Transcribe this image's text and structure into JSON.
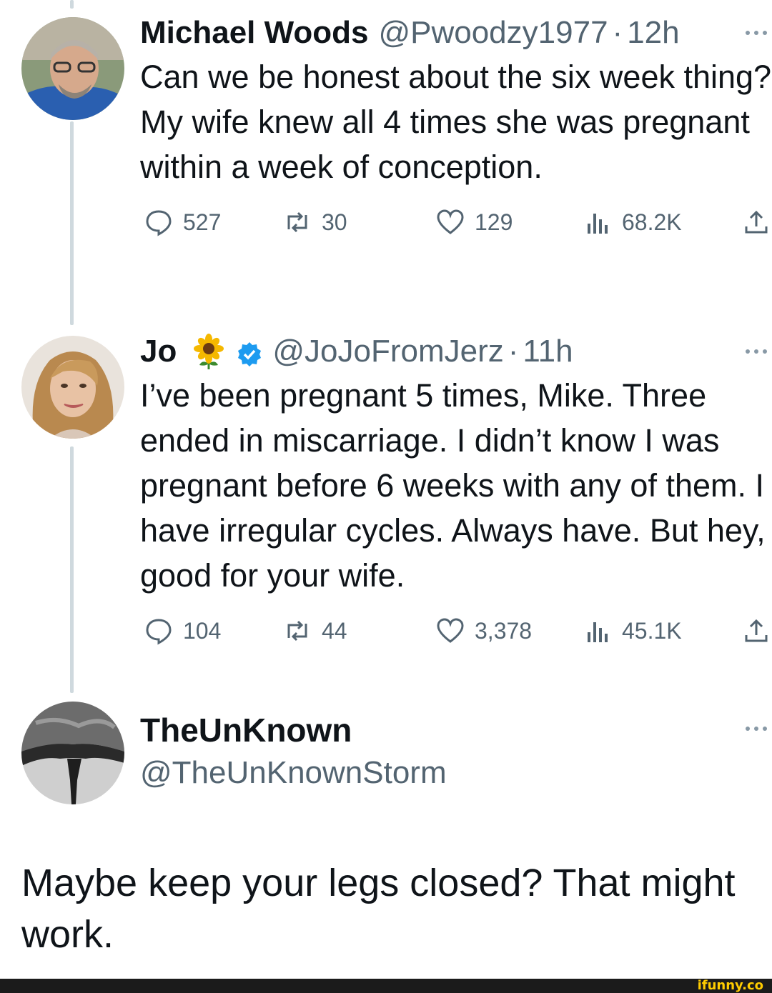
{
  "tweets": [
    {
      "name": "Michael Woods",
      "handle": "@Pwoodzy1977",
      "separator": "·",
      "time": "12h",
      "text": "Can we be honest about the six week thing? My wife knew all 4 times she was pregnant within a week of conception.",
      "replies": "527",
      "retweets": "30",
      "likes": "129",
      "views": "68.2K"
    },
    {
      "name": "Jo",
      "verified": true,
      "handle": "@JoJoFromJerz",
      "separator": "·",
      "time": "11h",
      "text": "I’ve been pregnant 5 times, Mike. Three ended in miscarriage. I didn’t know I was pregnant before 6 weeks with any of them. I have irregular cycles. Always have. But hey, good for your wife.",
      "replies": "104",
      "retweets": "44",
      "likes": "3,378",
      "views": "45.1K"
    },
    {
      "name": "TheUnKnown",
      "handle": "@TheUnKnownStorm",
      "text": "Maybe keep your legs closed? That might work."
    }
  ],
  "watermark": "ifunny.co",
  "colors": {
    "text": "#0f1419",
    "secondary": "#536471",
    "thread_line": "#cfd9de",
    "verified": "#1d9bf0"
  }
}
